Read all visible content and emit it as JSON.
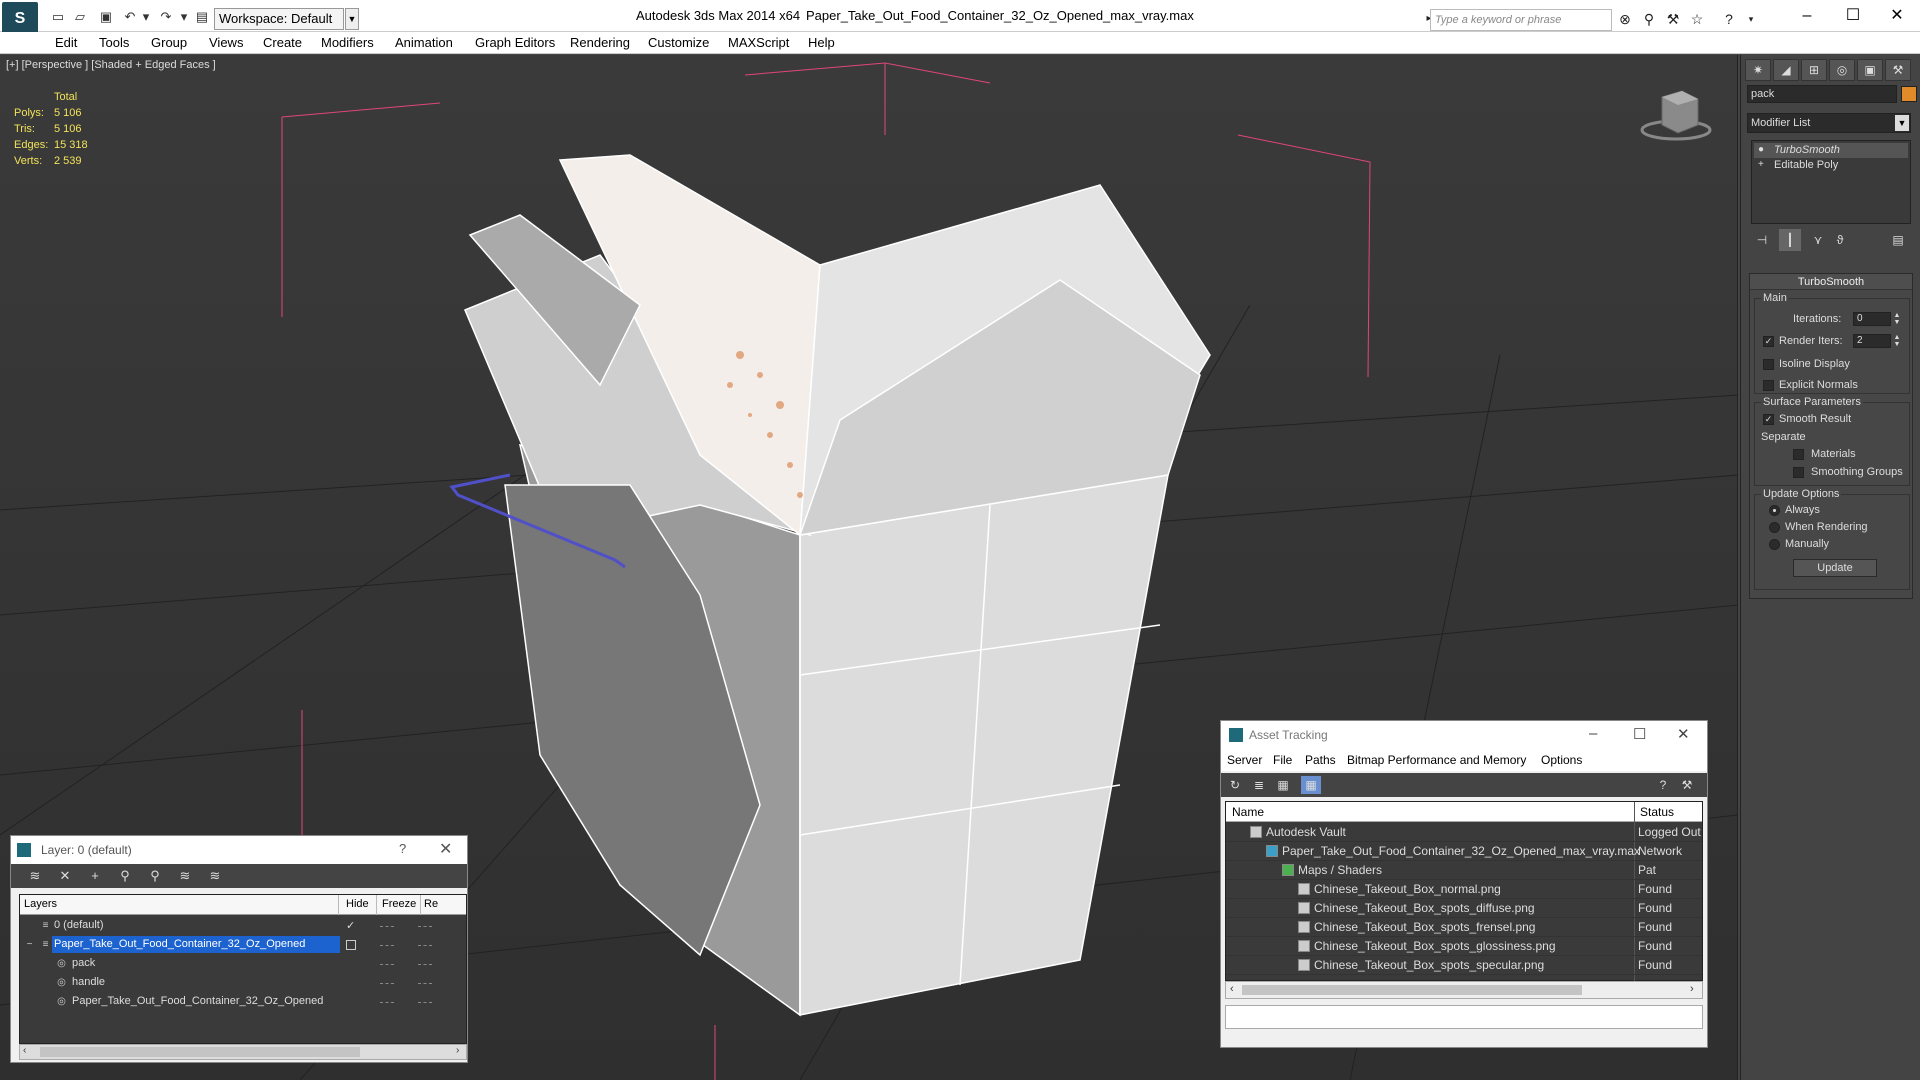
{
  "titlebar": {
    "workspace": "Workspace: Default",
    "app_title": "Autodesk 3ds Max  2014 x64",
    "doc_title": "Paper_Take_Out_Food_Container_32_Oz_Opened_max_vray.max",
    "search_placeholder": "Type a keyword or phrase"
  },
  "menu": [
    "Edit",
    "Tools",
    "Group",
    "Views",
    "Create",
    "Modifiers",
    "Animation",
    "Graph Editors",
    "Rendering",
    "Customize",
    "MAXScript",
    "Help"
  ],
  "viewport": {
    "label": "[+] [Perspective ] [Shaded + Edged Faces ]",
    "stats_header": "Total",
    "stats": [
      {
        "label": "Polys:",
        "value": "5 106"
      },
      {
        "label": "Tris:",
        "value": "5 106"
      },
      {
        "label": "Edges:",
        "value": "15 318"
      },
      {
        "label": "Verts:",
        "value": "2 539"
      }
    ]
  },
  "command_panel": {
    "object_name": "pack",
    "object_color": "#e08a2a",
    "modifier_list": "Modifier List",
    "stack": [
      "TurboSmooth",
      "Editable Poly"
    ],
    "rollout_title": "TurboSmooth",
    "main_group": "Main",
    "iterations_label": "Iterations:",
    "iterations_value": "0",
    "render_iters_label": "Render Iters:",
    "render_iters_value": "2",
    "isoline_label": "Isoline Display",
    "explicit_normals_label": "Explicit Normals",
    "surface_group": "Surface Parameters",
    "smooth_result_label": "Smooth Result",
    "separate_label": "Separate",
    "materials_label": "Materials",
    "smoothing_groups_label": "Smoothing Groups",
    "update_group": "Update Options",
    "always_label": "Always",
    "when_rendering_label": "When Rendering",
    "manually_label": "Manually",
    "update_button": "Update"
  },
  "layer_dialog": {
    "title": "Layer: 0 (default)",
    "help": "?",
    "columns": [
      "Layers",
      "Hide",
      "Freeze",
      "Re"
    ],
    "rows": [
      {
        "name": "0 (default)",
        "indent": 0
      },
      {
        "name": "Paper_Take_Out_Food_Container_32_Oz_Opened",
        "indent": 0
      },
      {
        "name": "pack",
        "indent": 1
      },
      {
        "name": "handle",
        "indent": 1
      },
      {
        "name": "Paper_Take_Out_Food_Container_32_Oz_Opened",
        "indent": 1
      }
    ]
  },
  "asset_dialog": {
    "title": "Asset Tracking",
    "menu": [
      "Server",
      "File",
      "Paths",
      "Bitmap Performance and Memory",
      "Options"
    ],
    "columns": [
      "Name",
      "Status"
    ],
    "rows": [
      {
        "name": "Autodesk Vault",
        "status": "Logged Out",
        "indent": 1
      },
      {
        "name": "Paper_Take_Out_Food_Container_32_Oz_Opened_max_vray.max",
        "status": "Network Pat",
        "indent": 2
      },
      {
        "name": "Maps / Shaders",
        "status": "",
        "indent": 3
      },
      {
        "name": "Chinese_Takeout_Box_normal.png",
        "status": "Found",
        "indent": 4
      },
      {
        "name": "Chinese_Takeout_Box_spots_diffuse.png",
        "status": "Found",
        "indent": 4
      },
      {
        "name": "Chinese_Takeout_Box_spots_frensel.png",
        "status": "Found",
        "indent": 4
      },
      {
        "name": "Chinese_Takeout_Box_spots_glossiness.png",
        "status": "Found",
        "indent": 4
      },
      {
        "name": "Chinese_Takeout_Box_spots_specular.png",
        "status": "Found",
        "indent": 4
      }
    ]
  }
}
